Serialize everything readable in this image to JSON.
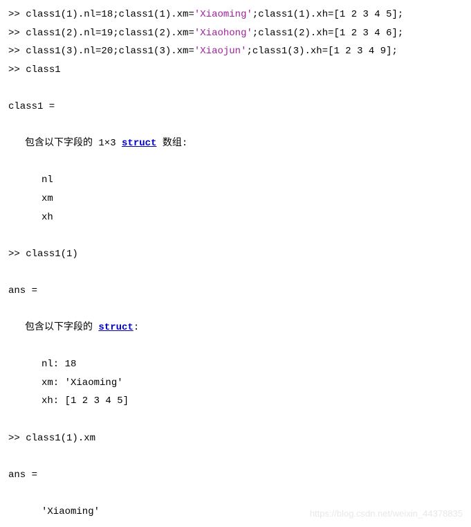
{
  "prompt": ">> ",
  "lines": {
    "l1": {
      "p1": "class1(1).nl=18;class1(1).xm=",
      "s1": "'Xiaoming'",
      "p2": ";class1(1).xh=[1 2 3 4 5];"
    },
    "l2": {
      "p1": "class1(2).nl=19;class1(2).xm=",
      "s1": "'Xiaohong'",
      "p2": ";class1(2).xh=[1 2 3 4 6];"
    },
    "l3": {
      "p1": "class1(3).nl=20;class1(3).xm=",
      "s1": "'Xiaojun'",
      "p2": ";class1(3).xh=[1 2 3 4 9];"
    },
    "l4": "class1",
    "out1": "class1 = ",
    "out1_desc_pre": "包含以下字段的 1×3 ",
    "struct_link": "struct",
    "out1_desc_post": " 数组:",
    "field_nl": "nl",
    "field_xm": "xm",
    "field_xh": "xh",
    "l5": "class1(1)",
    "out2": "ans = ",
    "out2_desc_pre": "包含以下字段的 ",
    "out2_desc_post": ":",
    "ans_nl": "nl: 18",
    "ans_xm": "xm: 'Xiaoming'",
    "ans_xh": "xh: [1 2 3 4 5]",
    "l6": "class1(1).xm",
    "out3": "ans = ",
    "out3_val": "'Xiaoming'"
  },
  "watermark": "https://blog.csdn.net/weixin_44378835"
}
